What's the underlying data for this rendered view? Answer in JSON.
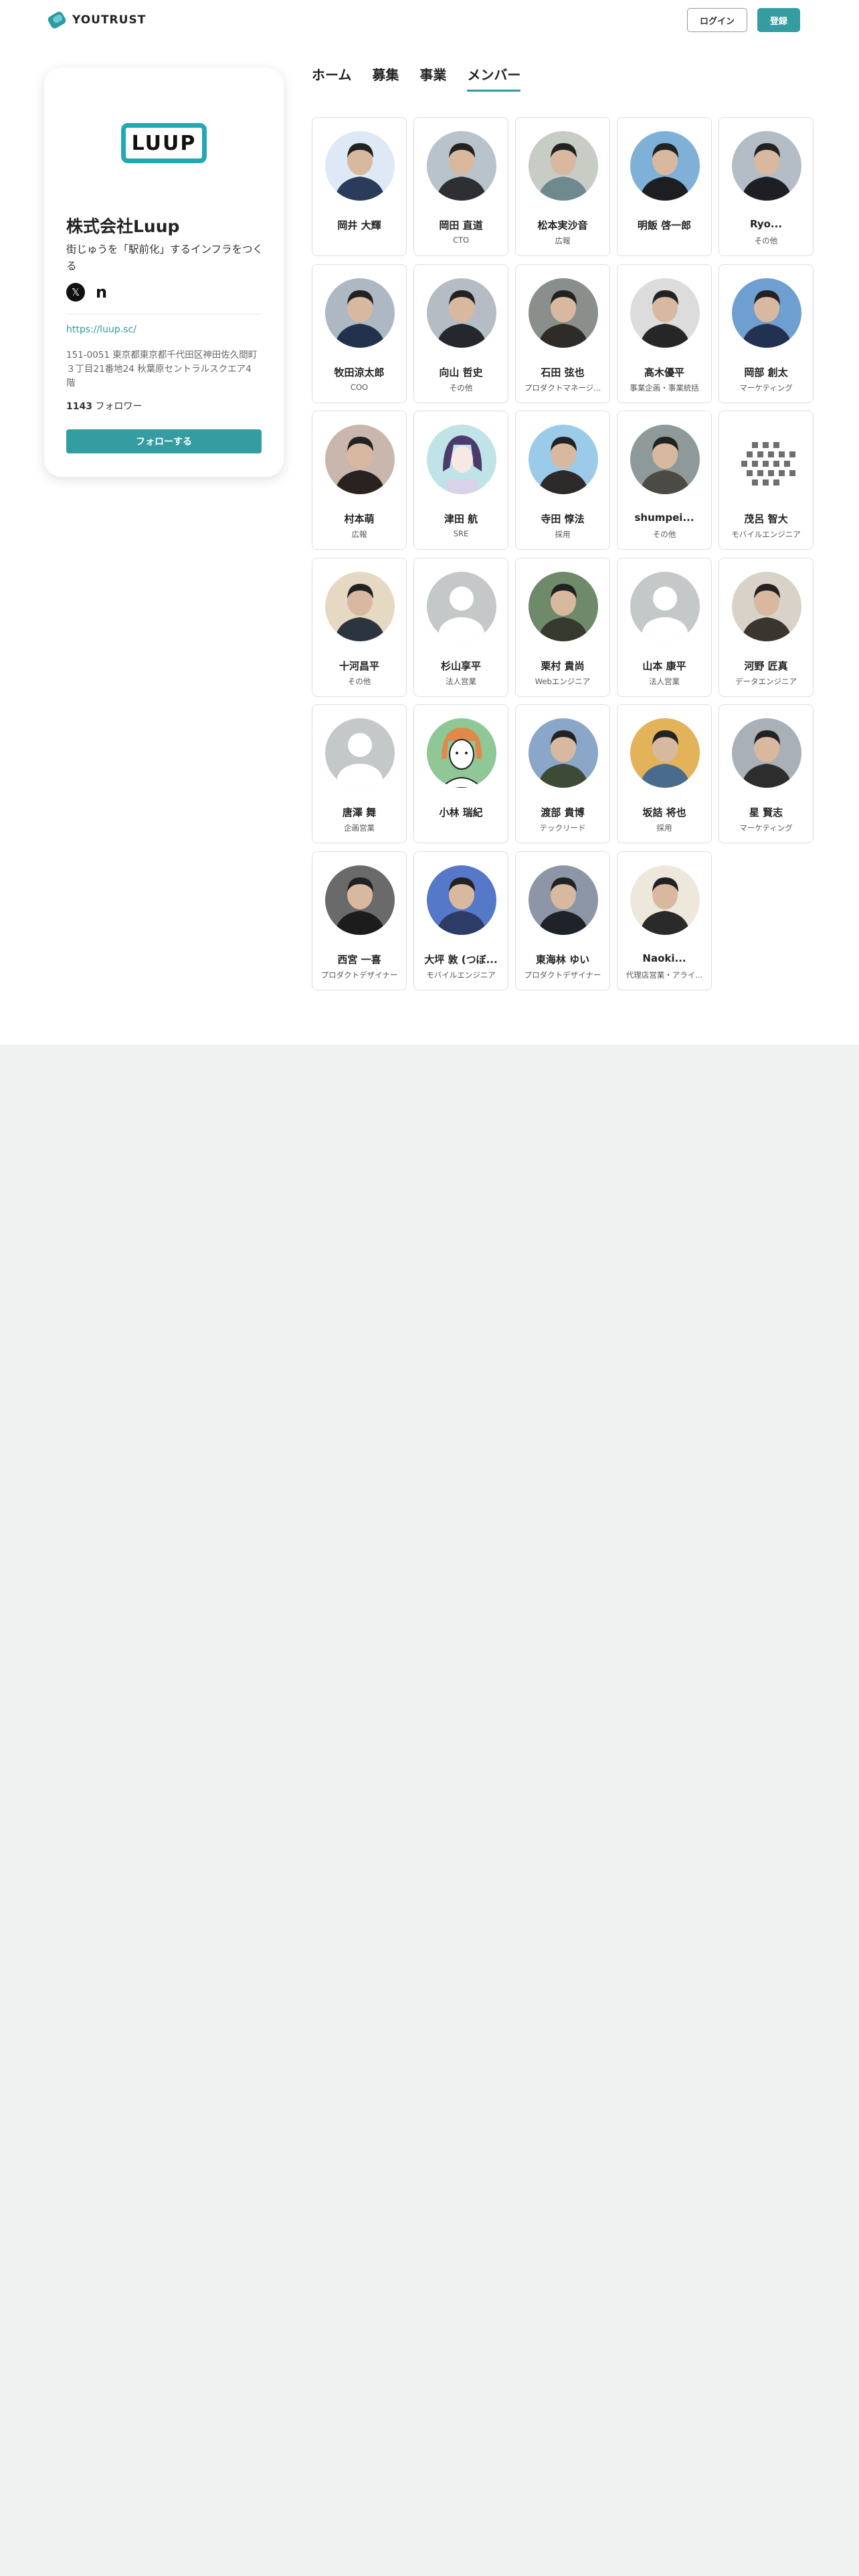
{
  "header": {
    "brand": "YOUTRUST",
    "login_label": "ログイン",
    "register_label": "登録",
    "brand_color": "#359ca1"
  },
  "company": {
    "logo_text": "LUUP",
    "name": "株式会社Luup",
    "tagline": "街じゅうを「駅前化」するインフラをつくる",
    "social": {
      "x_icon": "𝕏",
      "note_icon": "n"
    },
    "website": "https://luup.sc/",
    "address": "151-0051 東京都東京都千代田区神田佐久間町３丁目21番地24 秋葉原セントラルスクエア4階",
    "followers_count": "1143",
    "followers_label": "フォロワー",
    "follow_label": "フォローする"
  },
  "tabs": [
    {
      "label": "ホーム",
      "active": false
    },
    {
      "label": "募集",
      "active": false
    },
    {
      "label": "事業",
      "active": false
    },
    {
      "label": "メンバー",
      "active": true
    }
  ],
  "members": [
    {
      "name": "岡井 大輝",
      "role": "",
      "avatar": "photo",
      "color": "#2b3b5c",
      "bg": "#dfe9f5"
    },
    {
      "name": "岡田 直道",
      "role": "CTO",
      "avatar": "photo",
      "color": "#2e2f33",
      "bg": "#b8c3cc"
    },
    {
      "name": "松本実沙音",
      "role": "広報",
      "avatar": "photo",
      "color": "#6f8a8f",
      "bg": "#c7ccc4"
    },
    {
      "name": "明飯 啓一郎",
      "role": "",
      "avatar": "photo",
      "color": "#1e1e22",
      "bg": "#7fb0d8"
    },
    {
      "name": "Ryo...",
      "role": "その他",
      "avatar": "photo",
      "color": "#1e1f24",
      "bg": "#b4bdc6"
    },
    {
      "name": "牧田涼太郎",
      "role": "COO",
      "avatar": "photo",
      "color": "#22324d",
      "bg": "#aeb8c2"
    },
    {
      "name": "向山 哲史",
      "role": "その他",
      "avatar": "photo",
      "color": "#24272c",
      "bg": "#b6bcc4"
    },
    {
      "name": "石田 弦也",
      "role": "プロダクトマネージ...",
      "avatar": "photo",
      "color": "#2f2b29",
      "bg": "#8a8f8c"
    },
    {
      "name": "髙木優平",
      "role": "事業企画・事業統括",
      "avatar": "photo",
      "color": "#262626",
      "bg": "#dcdcdc"
    },
    {
      "name": "岡部 創太",
      "role": "マーケティング",
      "avatar": "photo",
      "color": "#22314f",
      "bg": "#6f9ed0"
    },
    {
      "name": "村本萌",
      "role": "広報",
      "avatar": "photo",
      "color": "#2a2220",
      "bg": "#c9b7ad"
    },
    {
      "name": "津田 航",
      "role": "SRE",
      "avatar": "illust",
      "color": "#4b3a6b",
      "bg": "#bfe3e6"
    },
    {
      "name": "寺田 惇法",
      "role": "採用",
      "avatar": "photo",
      "color": "#2f2a2a",
      "bg": "#9ccbe9"
    },
    {
      "name": "shumpei...",
      "role": "その他",
      "avatar": "photo",
      "color": "#4c4a44",
      "bg": "#8e9a99"
    },
    {
      "name": "茂呂 智大",
      "role": "モバイルエンジニア",
      "avatar": "pattern",
      "color": "#6e6e6e",
      "bg": "#ffffff"
    },
    {
      "name": "十河昌平",
      "role": "その他",
      "avatar": "photo",
      "color": "#2c3440",
      "bg": "#e6d9c4"
    },
    {
      "name": "杉山享平",
      "role": "法人営業",
      "avatar": "default",
      "color": "#ffffff",
      "bg": "#c4c8c9"
    },
    {
      "name": "栗村 貴尚",
      "role": "Webエンジニア",
      "avatar": "photo",
      "color": "#35392e",
      "bg": "#6f8a6a"
    },
    {
      "name": "山本 康平",
      "role": "法人営業",
      "avatar": "default",
      "color": "#ffffff",
      "bg": "#c4c8c9"
    },
    {
      "name": "河野 匠真",
      "role": "データエンジニア",
      "avatar": "photo",
      "color": "#3b3530",
      "bg": "#d8d2c8"
    },
    {
      "name": "唐澤 舞",
      "role": "企画営業",
      "avatar": "default",
      "color": "#ffffff",
      "bg": "#c4c8c9"
    },
    {
      "name": "小林 瑞紀",
      "role": "",
      "avatar": "illust2",
      "color": "#e08a4a",
      "bg": "#8fc797"
    },
    {
      "name": "渡部 貴博",
      "role": "テックリード",
      "avatar": "photo",
      "color": "#3d4a36",
      "bg": "#8aa6c8"
    },
    {
      "name": "坂詰 将也",
      "role": "採用",
      "avatar": "photo",
      "color": "#4a6c8c",
      "bg": "#e3b35a"
    },
    {
      "name": "星 賢志",
      "role": "マーケティング",
      "avatar": "photo",
      "color": "#2d2d2d",
      "bg": "#a9b0b8"
    },
    {
      "name": "西宮 一喜",
      "role": "プロダクトデザイナー",
      "avatar": "photo",
      "color": "#1c1c1c",
      "bg": "#6a6a6a"
    },
    {
      "name": "大坪 敦 (つぼ...",
      "role": "モバイルエンジニア",
      "avatar": "photo",
      "color": "#2d3c66",
      "bg": "#5678c8"
    },
    {
      "name": "東海林 ゆい",
      "role": "プロダクトデザイナー",
      "avatar": "photo",
      "color": "#1f2228",
      "bg": "#8d96a6"
    },
    {
      "name": "Naoki...",
      "role": "代理店営業・アライ...",
      "avatar": "photo",
      "color": "#2a2a2a",
      "bg": "#eee8dc"
    }
  ]
}
